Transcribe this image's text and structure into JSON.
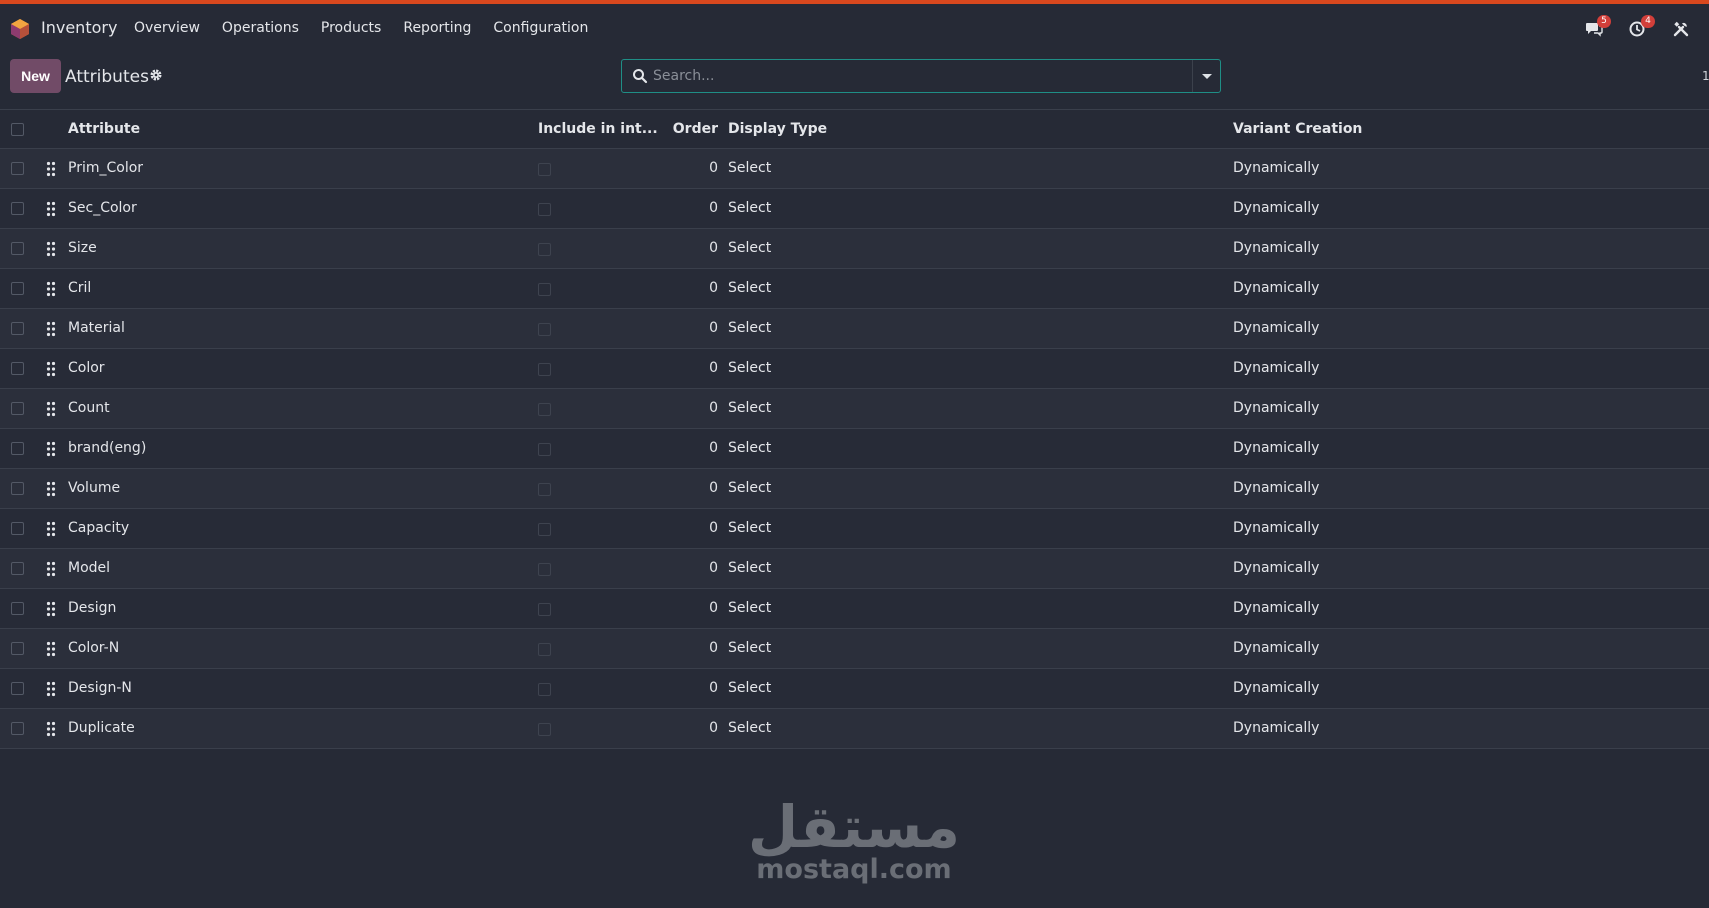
{
  "app": {
    "name": "Inventory",
    "accent_color": "#714b67",
    "top_bar_color": "#d9481e"
  },
  "menu": [
    "Overview",
    "Operations",
    "Products",
    "Reporting",
    "Configuration"
  ],
  "systray": {
    "messages_icon": "chat-icon",
    "messages_count": "5",
    "activity_icon": "clock-icon",
    "activity_count": "4",
    "debug_icon": "tools-icon"
  },
  "control_panel": {
    "new_label": "New",
    "title": "Attributes",
    "gear_icon": "gear-icon",
    "search_placeholder": "Search..."
  },
  "table": {
    "columns": [
      "Attribute",
      "Include in int...",
      "Order",
      "Display Type",
      "Variant Creation"
    ],
    "rows": [
      {
        "attribute": "Prim_Color",
        "order": "0",
        "display_type": "Select",
        "variant_creation": "Dynamically"
      },
      {
        "attribute": "Sec_Color",
        "order": "0",
        "display_type": "Select",
        "variant_creation": "Dynamically"
      },
      {
        "attribute": "Size",
        "order": "0",
        "display_type": "Select",
        "variant_creation": "Dynamically"
      },
      {
        "attribute": "Cril",
        "order": "0",
        "display_type": "Select",
        "variant_creation": "Dynamically"
      },
      {
        "attribute": "Material",
        "order": "0",
        "display_type": "Select",
        "variant_creation": "Dynamically"
      },
      {
        "attribute": "Color",
        "order": "0",
        "display_type": "Select",
        "variant_creation": "Dynamically"
      },
      {
        "attribute": "Count",
        "order": "0",
        "display_type": "Select",
        "variant_creation": "Dynamically"
      },
      {
        "attribute": "brand(eng)",
        "order": "0",
        "display_type": "Select",
        "variant_creation": "Dynamically"
      },
      {
        "attribute": "Volume",
        "order": "0",
        "display_type": "Select",
        "variant_creation": "Dynamically"
      },
      {
        "attribute": "Capacity",
        "order": "0",
        "display_type": "Select",
        "variant_creation": "Dynamically"
      },
      {
        "attribute": "Model",
        "order": "0",
        "display_type": "Select",
        "variant_creation": "Dynamically"
      },
      {
        "attribute": "Design",
        "order": "0",
        "display_type": "Select",
        "variant_creation": "Dynamically"
      },
      {
        "attribute": "Color-N",
        "order": "0",
        "display_type": "Select",
        "variant_creation": "Dynamically"
      },
      {
        "attribute": "Design-N",
        "order": "0",
        "display_type": "Select",
        "variant_creation": "Dynamically"
      },
      {
        "attribute": "Duplicate",
        "order": "0",
        "display_type": "Select",
        "variant_creation": "Dynamically"
      }
    ]
  },
  "watermark": {
    "arabic": "مستقل",
    "latin": "mostaql.com"
  }
}
